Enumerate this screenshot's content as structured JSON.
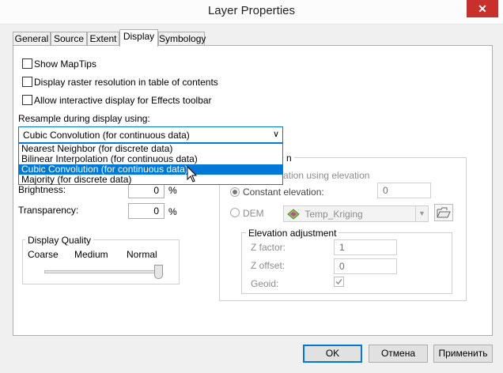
{
  "window": {
    "title": "Layer Properties",
    "close_glyph": "✕"
  },
  "tabs": [
    {
      "label": "General"
    },
    {
      "label": "Source"
    },
    {
      "label": "Extent"
    },
    {
      "label": "Display",
      "active": true
    },
    {
      "label": "Symbology"
    }
  ],
  "display": {
    "show_maptips": "Show MapTips",
    "display_raster_res": "Display raster resolution in table of contents",
    "allow_interactive": "Allow interactive display for Effects toolbar",
    "resample_label": "Resample during display using:",
    "resample_value": "Cubic Convolution (for continuous data)",
    "resample_options": [
      "Nearest Neighbor (for discrete data)",
      "Bilinear Interpolation (for continuous data)",
      "Cubic Convolution (for continuous data)",
      "Majority (for discrete data)"
    ],
    "resample_selected_index": 2,
    "brightness_label": "Brightness:",
    "brightness_value": "0",
    "transparency_label": "Transparency:",
    "transparency_value": "0",
    "percent_unit": "%",
    "quality_title": "Display Quality",
    "quality_coarse": "Coarse",
    "quality_medium": "Medium",
    "quality_normal": "Normal",
    "quality_level": 1.0
  },
  "elevation": {
    "group_title_partial": "n",
    "option_elevation_partial": "ation using elevation",
    "constant_label": "Constant elevation:",
    "constant_value": "0",
    "dem_label": "DEM",
    "dem_value": "Temp_Kriging",
    "adjust_title": "Elevation adjustment",
    "z_factor_label": "Z factor:",
    "z_factor_value": "1",
    "z_offset_label": "Z offset:",
    "z_offset_value": "0",
    "geoid_label": "Geoid:"
  },
  "buttons": {
    "ok": "OK",
    "cancel": "Отмена",
    "apply": "Применить"
  },
  "colors": {
    "accent": "#0078d7",
    "close_red": "#c7302b"
  }
}
